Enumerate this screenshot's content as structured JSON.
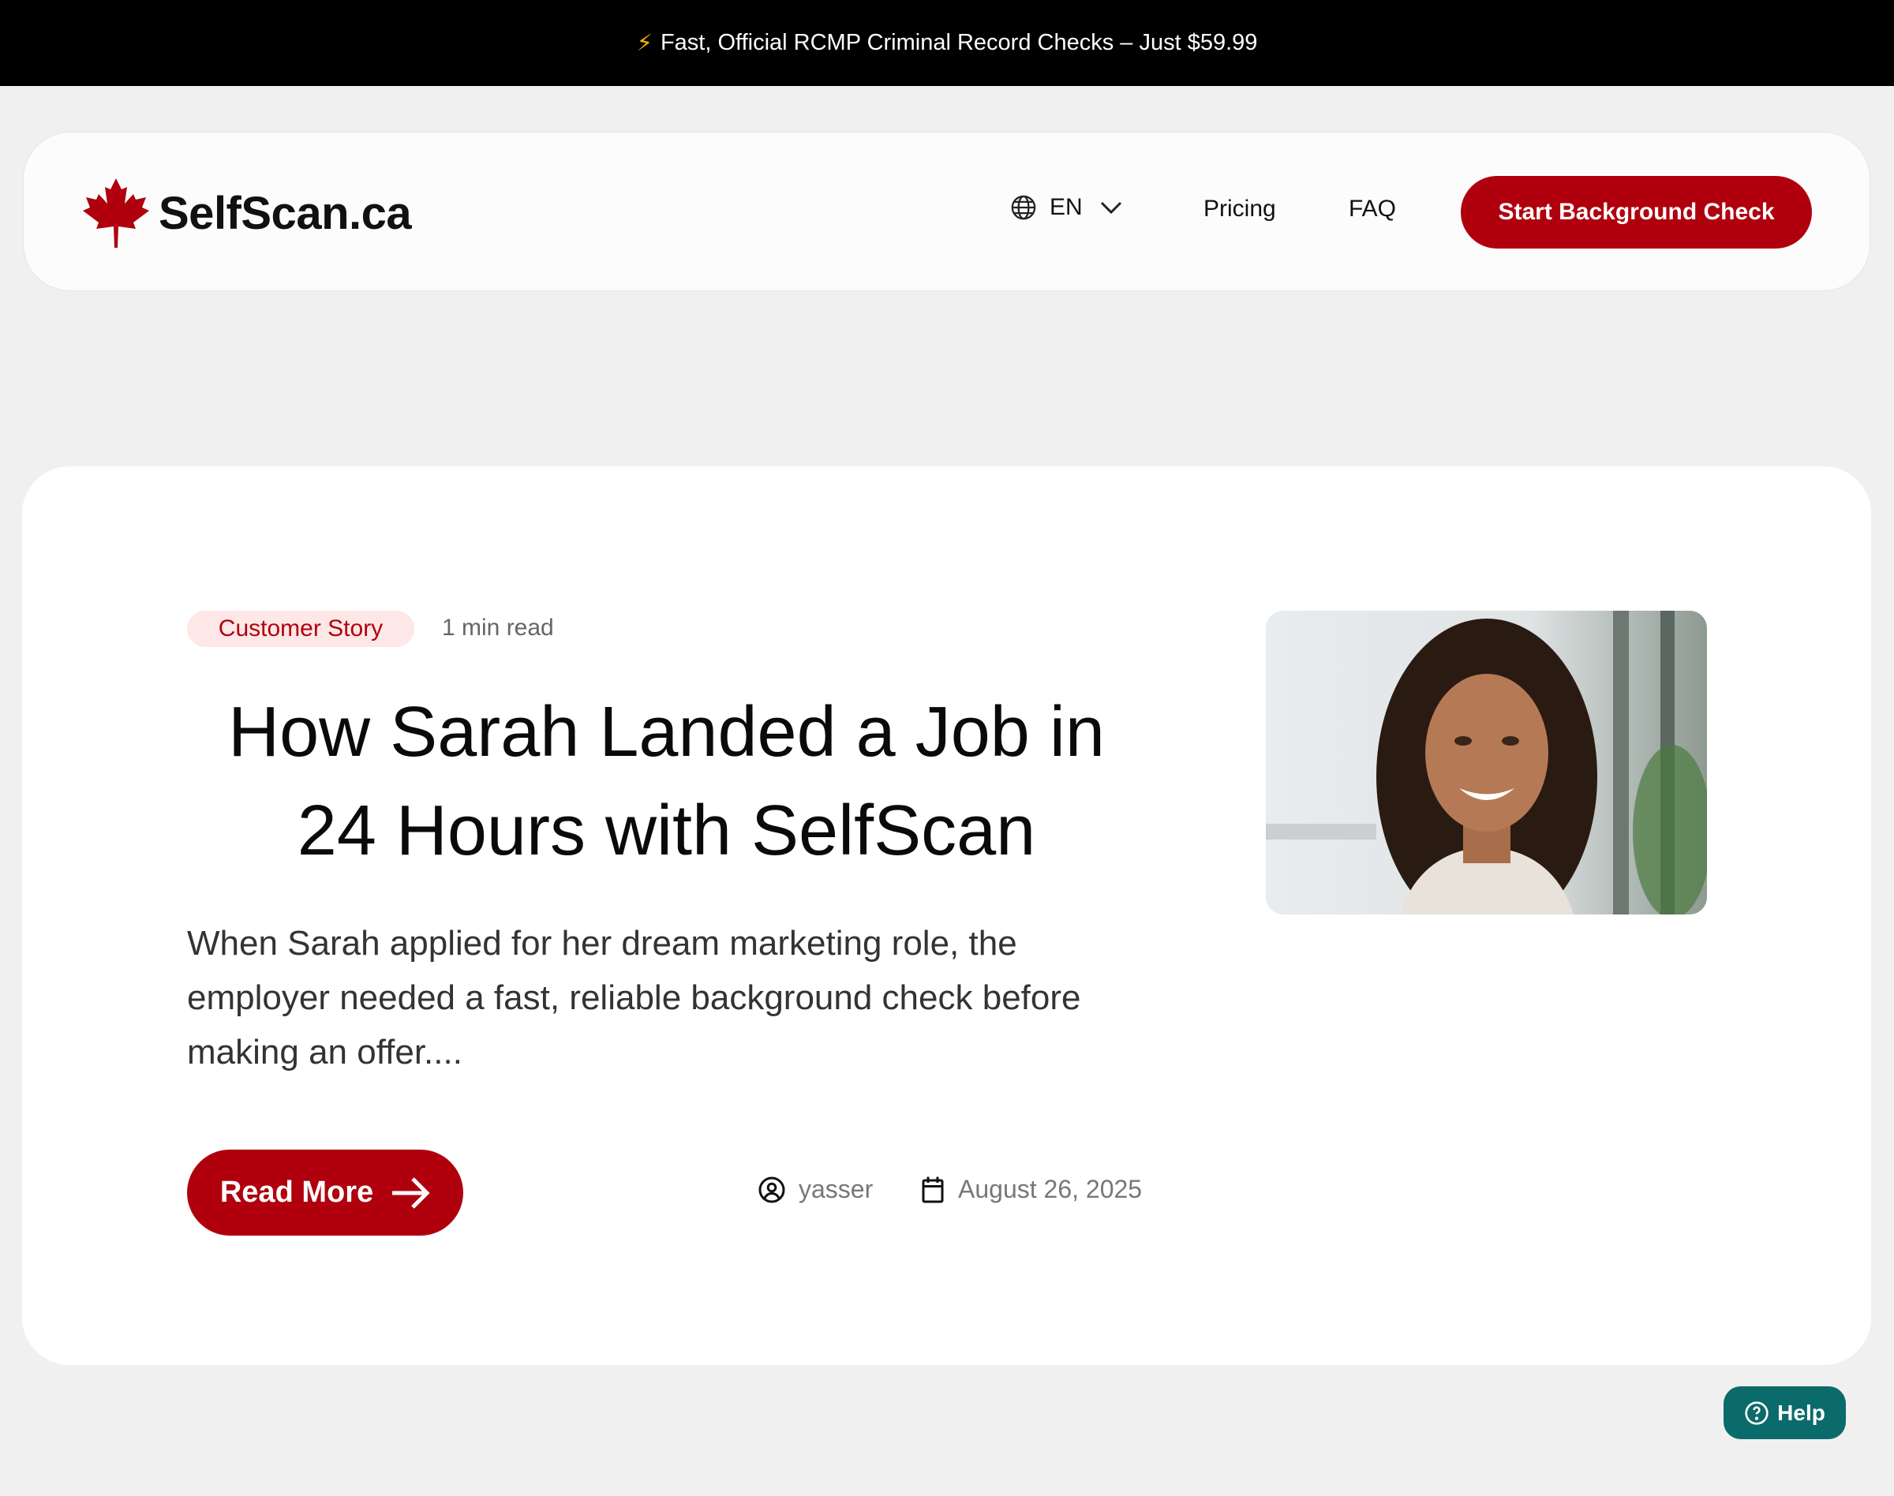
{
  "announcement": {
    "icon": "lightning-bolt-icon",
    "text": "Fast, Official RCMP Criminal Record Checks – Just $59.99"
  },
  "header": {
    "logo_text": "SelfScan.ca",
    "language": "EN",
    "nav": [
      "Pricing",
      "FAQ"
    ],
    "cta_label": "Start Background Check"
  },
  "post": {
    "category": "Customer Story",
    "read_time": "1 min read",
    "title_line1": "How Sarah Landed a Job in",
    "title_line2": "24 Hours with SelfScan",
    "excerpt": "When Sarah applied for her dream marketing role, the employer needed a fast, reliable background check before making an offer....",
    "read_more_label": "Read More",
    "author": "yasser",
    "date": "August 26, 2025"
  },
  "help_label": "Help",
  "colors": {
    "brand_red": "#b0000e",
    "help_teal": "#0b6b6b",
    "badge_bg": "#fde7e7"
  }
}
